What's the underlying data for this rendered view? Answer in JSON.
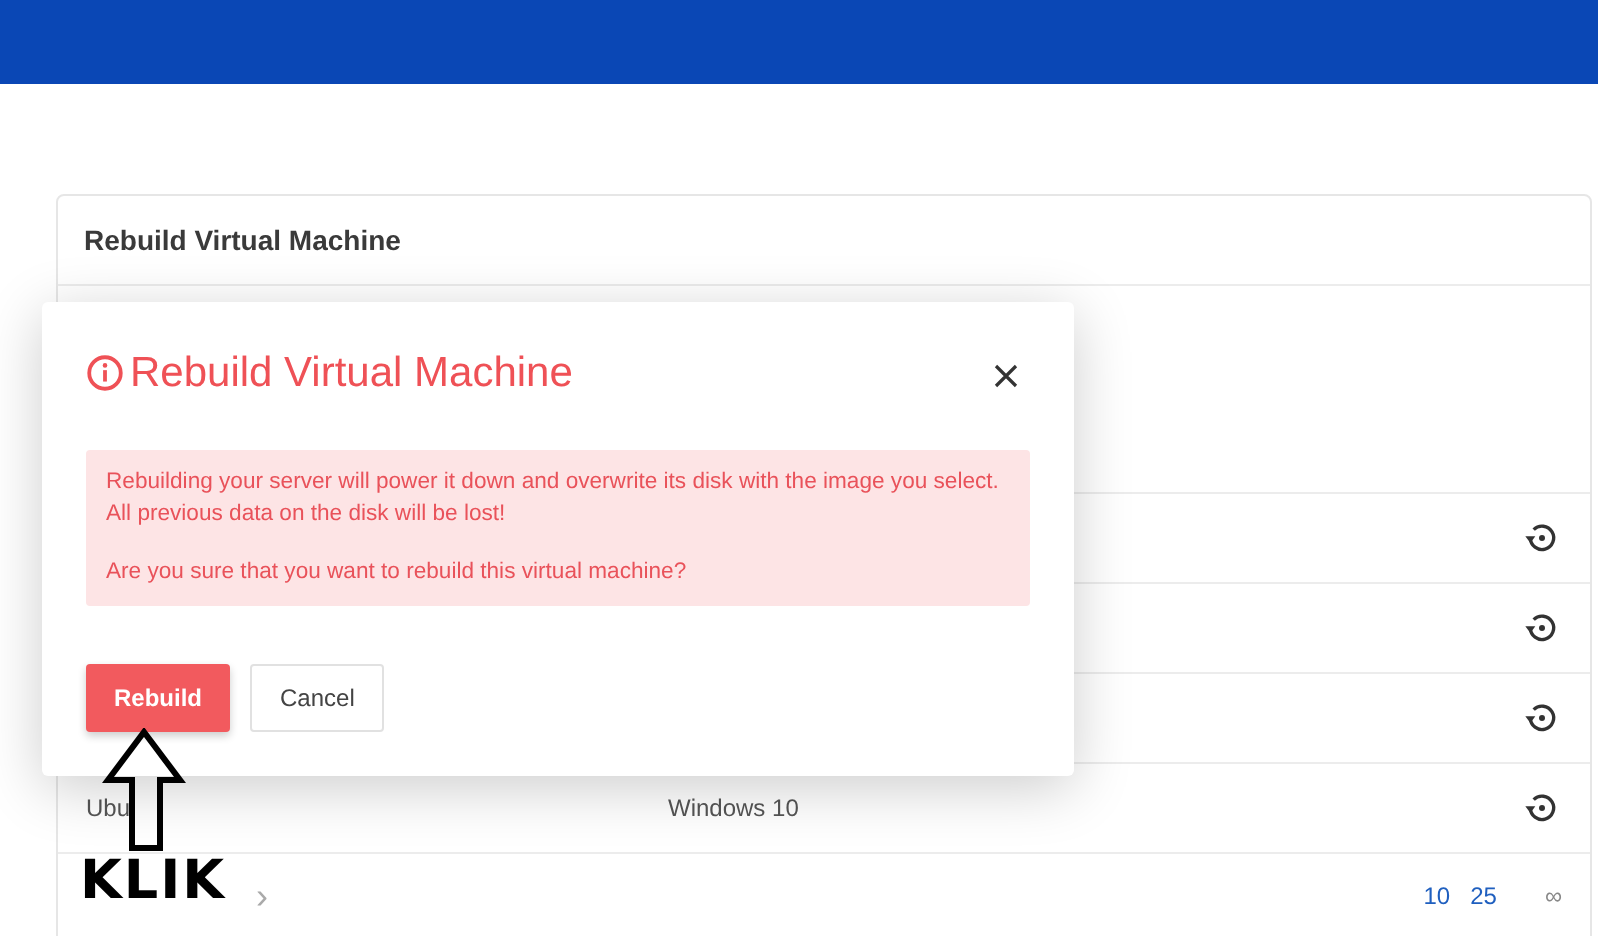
{
  "card": {
    "title": "Rebuild Virtual Machine"
  },
  "rows": [
    {},
    {},
    {},
    {
      "column_1": "Ubu",
      "column_2": "Windows 10"
    }
  ],
  "pagination": {
    "next": "›",
    "page_sizes": [
      {
        "label": "10",
        "selected": false
      },
      {
        "label": "25",
        "selected": false
      },
      {
        "label": "∞",
        "selected": true
      }
    ]
  },
  "modal": {
    "title": "Rebuild Virtual Machine",
    "message": [
      "Rebuilding your server will power it down and overwrite its disk with the image you select. All previous data on the disk will be lost!",
      "Are you sure that you want to rebuild this virtual machine?"
    ],
    "buttons": [
      {
        "label": "Rebuild",
        "kind": "danger"
      },
      {
        "label": "Cancel",
        "kind": "secondary"
      }
    ]
  },
  "annotation": {
    "label": "KLIK"
  }
}
